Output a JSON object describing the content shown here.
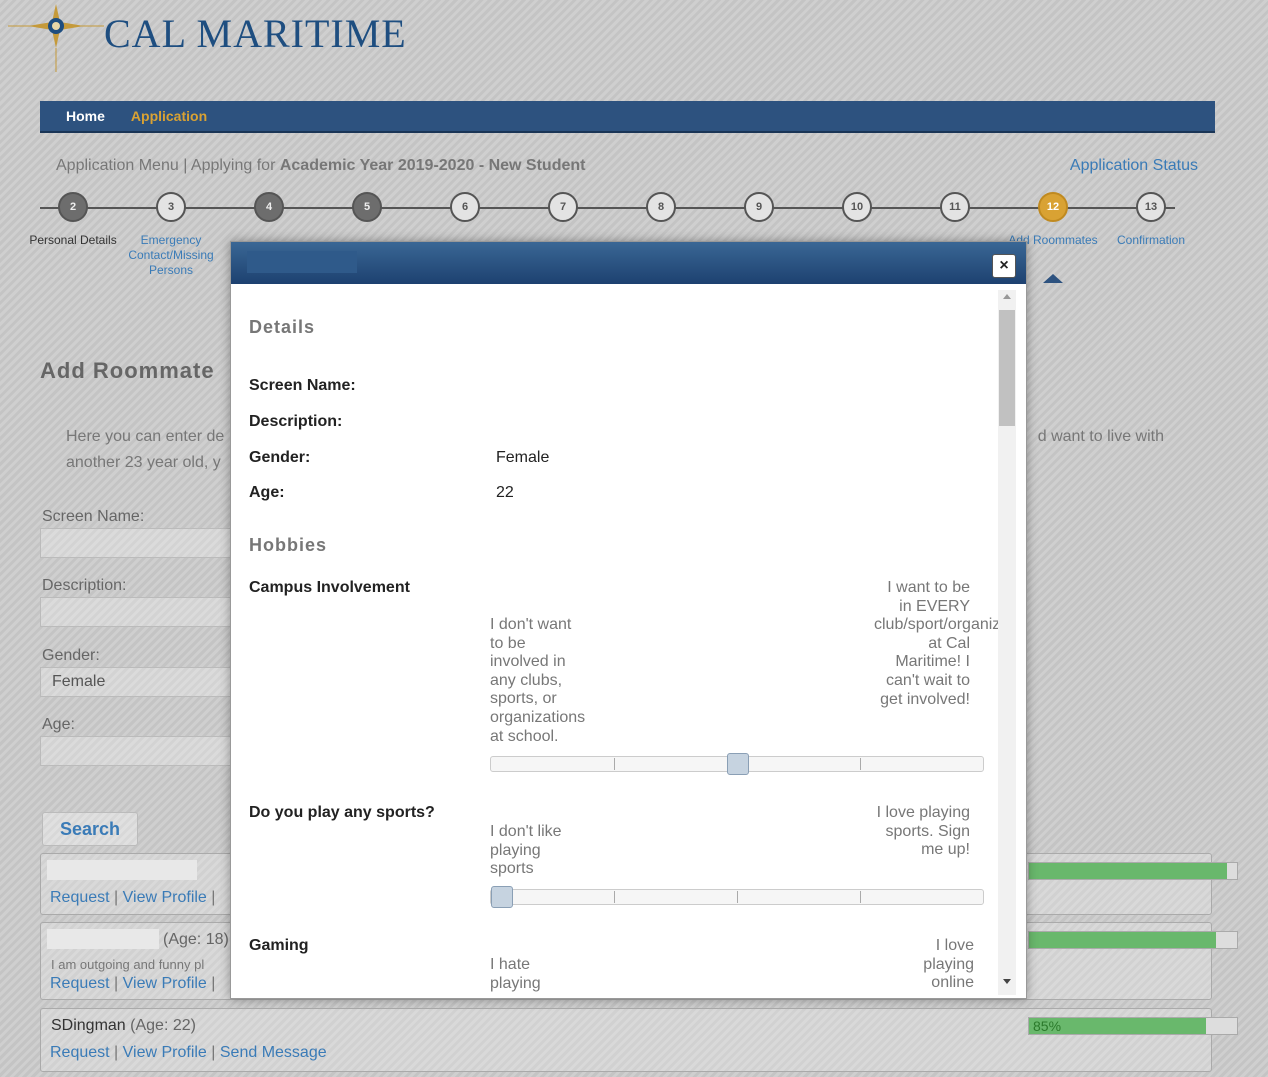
{
  "header": {
    "brand": "CAL MARITIME"
  },
  "nav": {
    "home": "Home",
    "application": "Application"
  },
  "app_menu": {
    "prefix": "Application Menu | Applying for ",
    "bold": "Academic Year 2019-2020 - New Student",
    "status_link": "Application Status"
  },
  "steps": [
    {
      "num": "2",
      "state": "done"
    },
    {
      "num": "3",
      "state": "todo"
    },
    {
      "num": "4",
      "state": "done"
    },
    {
      "num": "5",
      "state": "done"
    },
    {
      "num": "6",
      "state": "todo"
    },
    {
      "num": "7",
      "state": "todo"
    },
    {
      "num": "8",
      "state": "todo"
    },
    {
      "num": "9",
      "state": "todo"
    },
    {
      "num": "10",
      "state": "todo"
    },
    {
      "num": "11",
      "state": "todo"
    },
    {
      "num": "12",
      "state": "current"
    },
    {
      "num": "13",
      "state": "todo"
    }
  ],
  "step_labels": {
    "s2": "Personal Details",
    "s3": "Emergency Contact/Missing Persons",
    "s12": "Add Roommates",
    "s13": "Confirmation"
  },
  "main": {
    "title": "Add Roommate",
    "intro_line1_left": "Here you can enter de",
    "intro_line1_right": "d want to live with",
    "intro_line2": "another 23 year old, y",
    "screen_name_label": "Screen Name:",
    "description_label": "Description:",
    "gender_label": "Gender:",
    "gender_value": "Female",
    "age_label": "Age:",
    "search_button": "Search"
  },
  "results": [
    {
      "name": "",
      "age": "",
      "description": "",
      "match_percent": 95,
      "links": [
        "Request",
        "View Profile"
      ]
    },
    {
      "name": "",
      "age": "(Age: 18)",
      "description": "I am outgoing and funny pl",
      "match_percent": 90,
      "links": [
        "Request",
        "View Profile"
      ]
    },
    {
      "name": "SDingman",
      "age": "(Age: 22)",
      "description": "",
      "match_percent": 85,
      "match_text": "85%",
      "links": [
        "Request",
        "View Profile",
        "Send Message"
      ]
    }
  ],
  "modal": {
    "close_glyph": "×",
    "details_heading": "Details",
    "screen_name_label": "Screen Name:",
    "description_label": "Description:",
    "gender_label": "Gender:",
    "gender_value": "Female",
    "age_label": "Age:",
    "age_value": "22",
    "hobbies_heading": "Hobbies",
    "questions": [
      {
        "label": "Campus Involvement",
        "low": "I don't want to be involved in any clubs, sports, or organizations at school.",
        "high": "I want to be in EVERY club/sport/organization at Cal Maritime! I can't wait to get involved!",
        "value": 0.5
      },
      {
        "label": "Do you play any sports?",
        "low": "I don't like playing sports",
        "high": "I love playing sports. Sign me up!",
        "value": 0.0
      },
      {
        "label": "Gaming",
        "low": "I hate playing",
        "high": "I love playing online",
        "value": null
      }
    ]
  },
  "colors": {
    "nav_bg": "#2d527f",
    "accent_gold": "#d9a233",
    "link_blue": "#3a7bb7",
    "match_green": "#4caf50"
  }
}
